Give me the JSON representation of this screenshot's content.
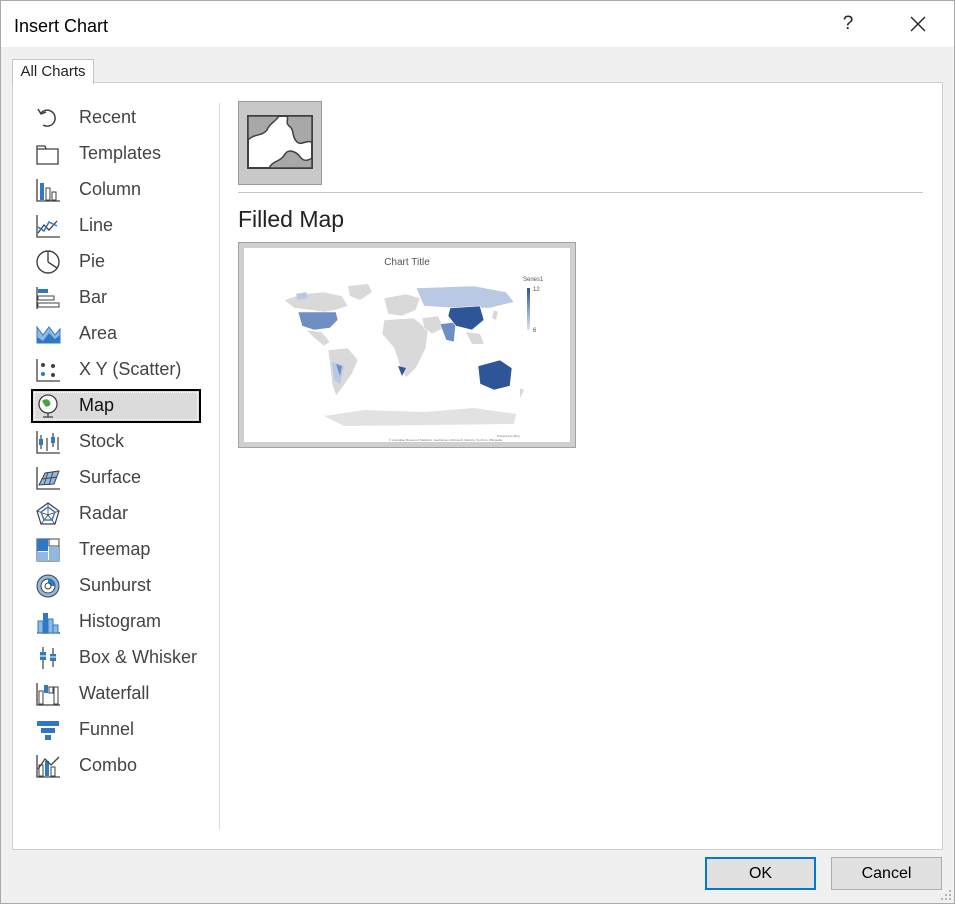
{
  "dialog": {
    "title": "Insert Chart",
    "help_label": "?",
    "close_icon": "close-icon"
  },
  "tabs": [
    {
      "label": "All Charts",
      "active": true
    }
  ],
  "sidebar": {
    "selected": "Map",
    "items": [
      {
        "label": "Recent",
        "icon": "recent-icon"
      },
      {
        "label": "Templates",
        "icon": "templates-icon"
      },
      {
        "label": "Column",
        "icon": "column-chart-icon"
      },
      {
        "label": "Line",
        "icon": "line-chart-icon"
      },
      {
        "label": "Pie",
        "icon": "pie-chart-icon"
      },
      {
        "label": "Bar",
        "icon": "bar-chart-icon"
      },
      {
        "label": "Area",
        "icon": "area-chart-icon"
      },
      {
        "label": "X Y (Scatter)",
        "icon": "scatter-chart-icon"
      },
      {
        "label": "Map",
        "icon": "map-chart-icon"
      },
      {
        "label": "Stock",
        "icon": "stock-chart-icon"
      },
      {
        "label": "Surface",
        "icon": "surface-chart-icon"
      },
      {
        "label": "Radar",
        "icon": "radar-chart-icon"
      },
      {
        "label": "Treemap",
        "icon": "treemap-chart-icon"
      },
      {
        "label": "Sunburst",
        "icon": "sunburst-chart-icon"
      },
      {
        "label": "Histogram",
        "icon": "histogram-chart-icon"
      },
      {
        "label": "Box & Whisker",
        "icon": "box-whisker-chart-icon"
      },
      {
        "label": "Waterfall",
        "icon": "waterfall-chart-icon"
      },
      {
        "label": "Funnel",
        "icon": "funnel-chart-icon"
      },
      {
        "label": "Combo",
        "icon": "combo-chart-icon"
      }
    ]
  },
  "main": {
    "subtype_icon": "filled-map-icon",
    "subtype_title": "Filled Map",
    "preview": {
      "chart_title": "Chart Title",
      "legend_title": "Series1",
      "legend_max": "12",
      "legend_min": "6",
      "credit_line1": "Powered by Bing",
      "credit_line2": "© Australian Bureau of Statistics, GeoNames, Microsoft, Navinfo, TomTom, Wikipedia",
      "colors": {
        "high": "#2e5597",
        "mid": "#6f8ec4",
        "low": "#b9c8e3",
        "none": "#d9d9d9"
      }
    }
  },
  "footer": {
    "ok_label": "OK",
    "cancel_label": "Cancel"
  },
  "colors": {
    "accent": "#0078d7",
    "icon_blue": "#2f78c4",
    "icon_dark": "#404040"
  }
}
